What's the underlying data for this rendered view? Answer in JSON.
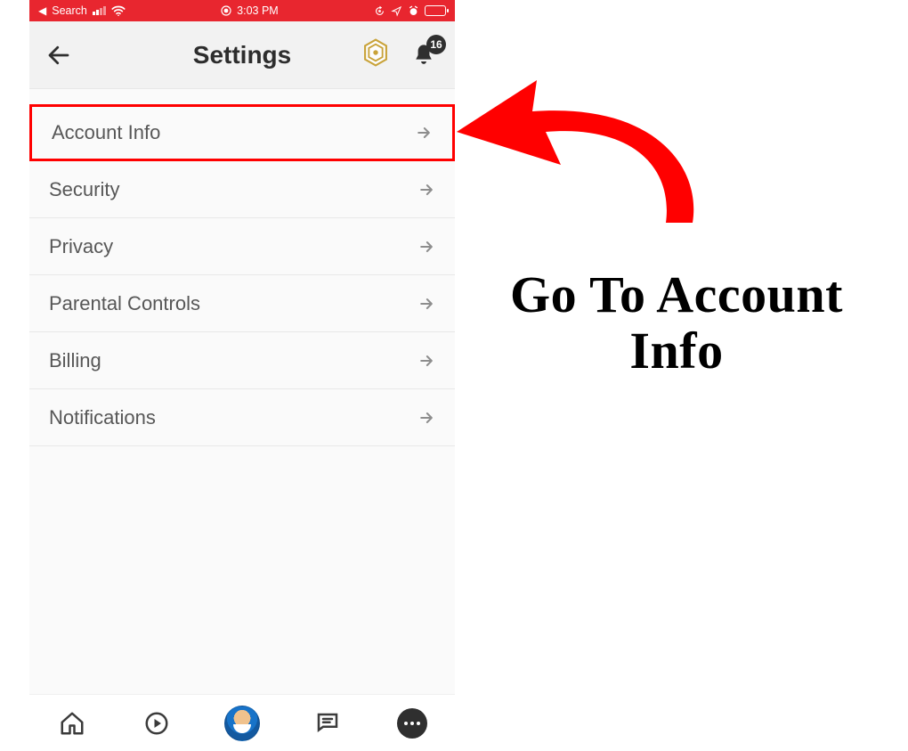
{
  "statusbar": {
    "back_app": "Search",
    "time": "3:03 PM"
  },
  "header": {
    "title": "Settings",
    "notification_count": "16"
  },
  "menu": {
    "items": [
      {
        "label": "Account Info",
        "highlighted": true
      },
      {
        "label": "Security"
      },
      {
        "label": "Privacy"
      },
      {
        "label": "Parental Controls"
      },
      {
        "label": "Billing"
      },
      {
        "label": "Notifications"
      }
    ]
  },
  "annotation": {
    "text": "Go To Account Info"
  },
  "colors": {
    "statusbar_bg": "#e8262f",
    "highlight": "#ff0000"
  }
}
